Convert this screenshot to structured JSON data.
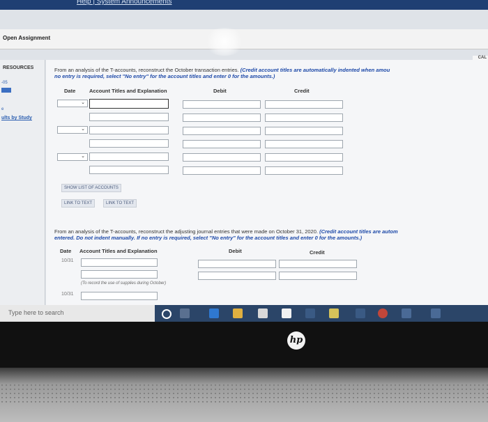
{
  "top_links": "Help | System Announcements",
  "assignment_bar": {
    "title": "Open Assignment"
  },
  "cal_label": "CAL",
  "left_panel": {
    "resources": "RESOURCES",
    "results_link": "ults by Study"
  },
  "section1": {
    "instruction_plain": "From an analysis of the T-accounts, reconstruct the October transaction entries.",
    "instruction_em_line1": "(Credit account titles are automatically indented when amou",
    "instruction_em_line2": "no entry is required, select \"No entry\" for the account titles and enter 0 for the amounts.)",
    "headers": {
      "date": "Date",
      "account": "Account Titles and Explanation",
      "debit": "Debit",
      "credit": "Credit"
    },
    "show_list_button": "SHOW LIST OF ACCOUNTS",
    "link1": "LINK TO TEXT",
    "link2": "LINK TO TEXT"
  },
  "section2": {
    "instruction_plain": "From an analysis of the T-accounts, reconstruct the adjusting journal entries that were made on October 31, 2020.",
    "instruction_em_line1": "(Credit account titles are autom",
    "instruction_em_line2": "entered. Do not indent manually. If no entry is required, select \"No entry\" for the account titles and enter 0 for the amounts.)",
    "headers": {
      "date": "Date",
      "account": "Account Titles and Explanation",
      "debit": "Debit",
      "credit": "Credit"
    },
    "row1_date": "10/31",
    "row1_note": "(To record the use of supplies during October)",
    "row2_date": "10/31"
  },
  "taskbar": {
    "search_placeholder": "Type here to search"
  },
  "device": {
    "logo": "hp"
  }
}
